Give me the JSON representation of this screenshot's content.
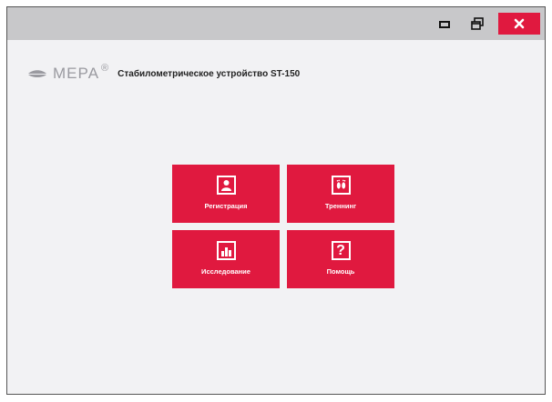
{
  "window": {
    "controls": {
      "minimize_icon": "minimize-icon",
      "maximize_icon": "restore-icon",
      "close_icon": "close-icon"
    },
    "colors": {
      "accent": "#e0193f",
      "titlebar": "#c8c8ca",
      "background": "#f2f2f4"
    }
  },
  "header": {
    "logo_text": "МЕРА",
    "logo_reg": "®",
    "device_title": "Стабилометрическое устройство ST-150"
  },
  "menu": {
    "tiles": [
      {
        "label": "Регистрация",
        "icon": "person-icon"
      },
      {
        "label": "Треннинг",
        "icon": "footprints-icon"
      },
      {
        "label": "Исследование",
        "icon": "bar-chart-icon"
      },
      {
        "label": "Помощь",
        "icon": "question-icon",
        "glyph": "?"
      }
    ]
  }
}
